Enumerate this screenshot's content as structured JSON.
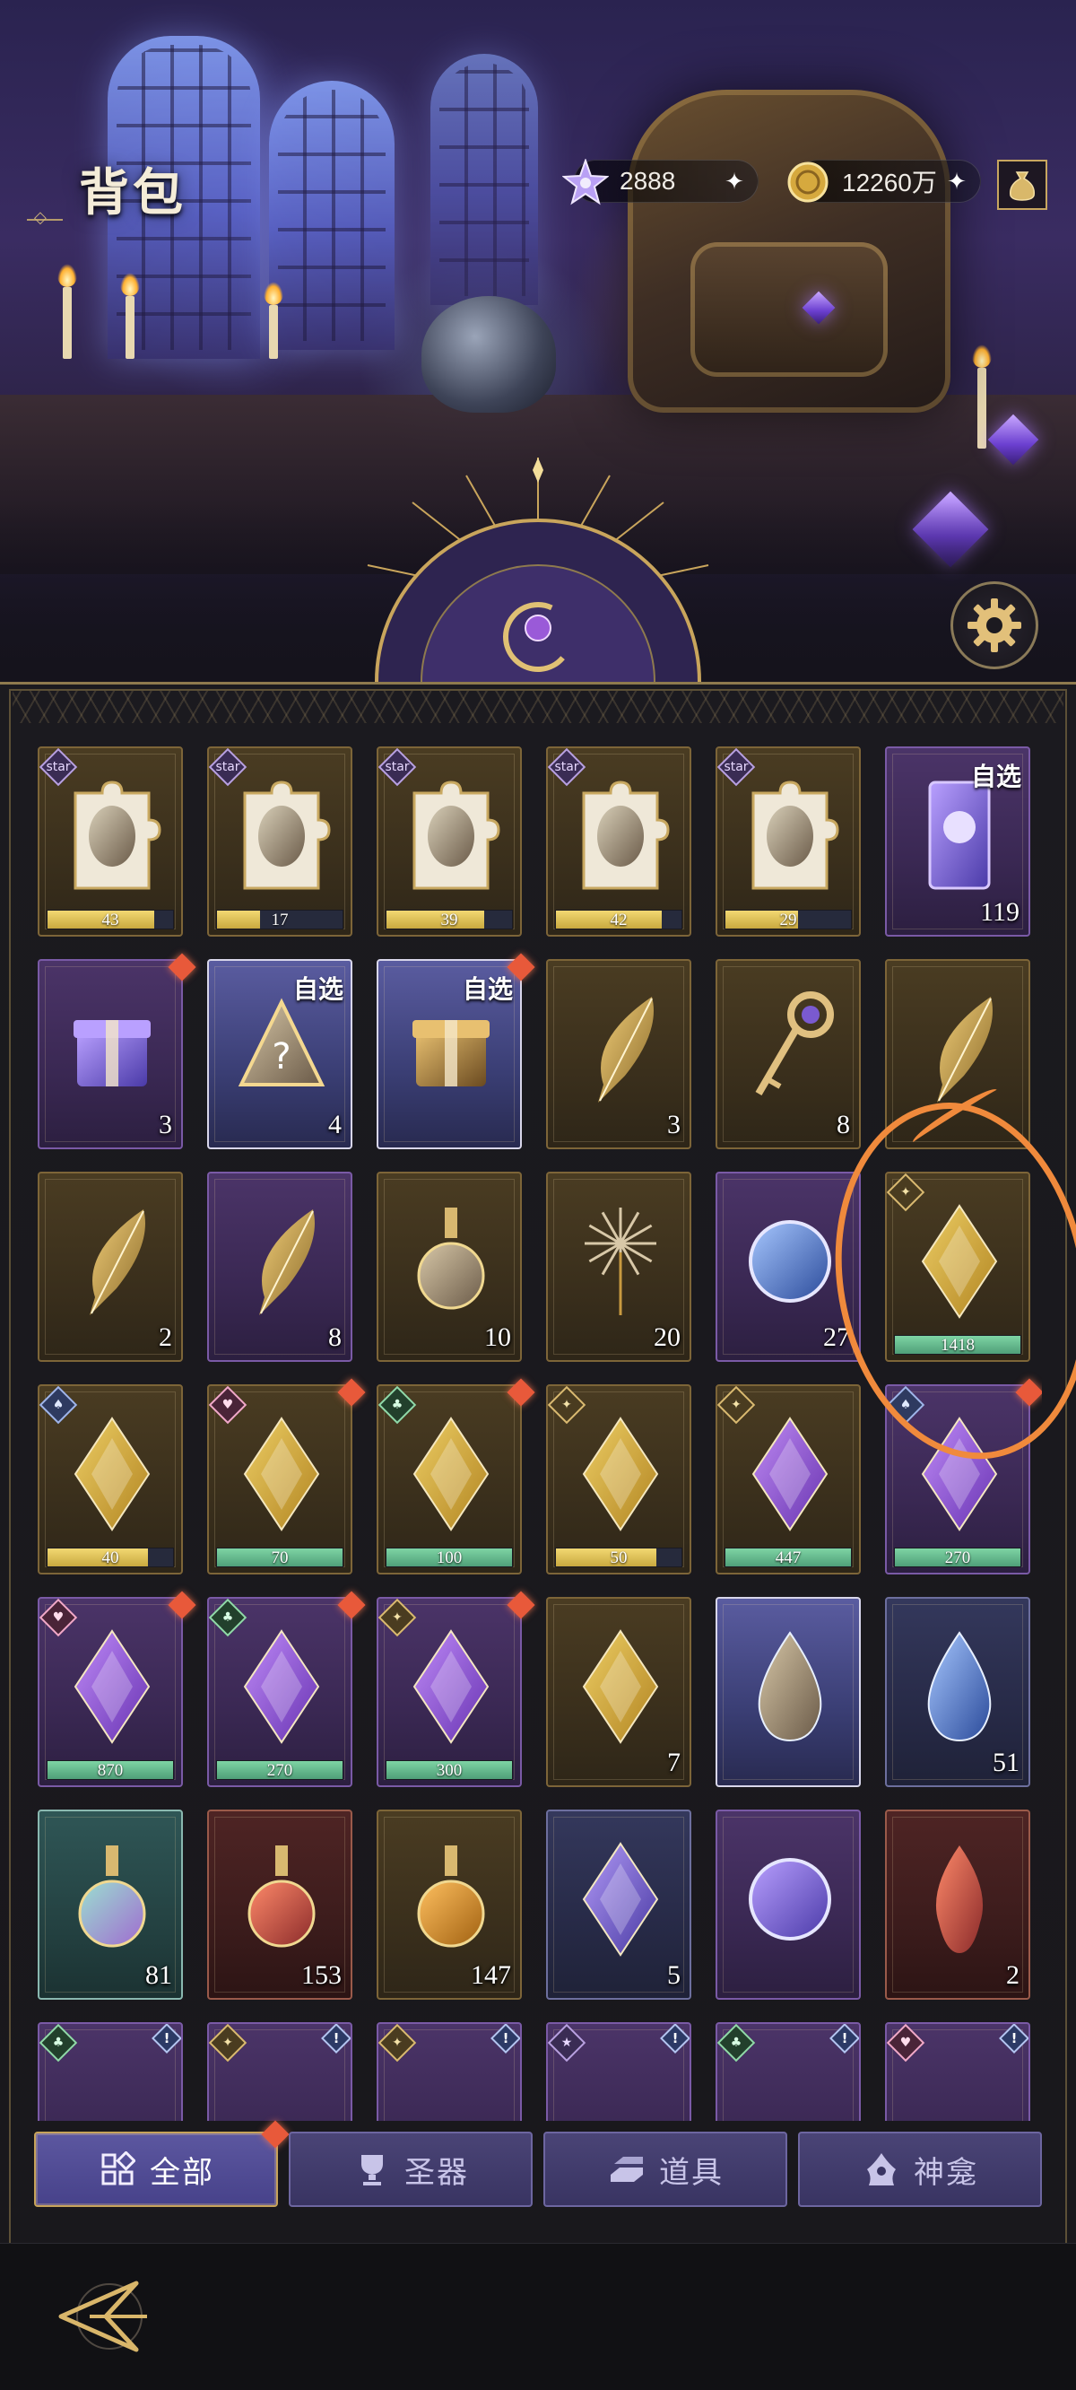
{
  "header": {
    "title": "背包",
    "currencies": [
      {
        "name": "star-crystal",
        "value": "2888"
      },
      {
        "name": "gold-coin",
        "value": "12260万"
      }
    ]
  },
  "items": [
    {
      "row": 0,
      "col": 0,
      "frame": "gold",
      "art": "puzzle-portrait-silver-hair",
      "badge": "star",
      "badge_color": "purple",
      "bar_value": "43",
      "bar_color": "yellow",
      "bar_fill": 0.85
    },
    {
      "row": 0,
      "col": 1,
      "frame": "gold",
      "art": "puzzle-portrait-dark-hair",
      "badge": "star",
      "badge_color": "purple",
      "bar_value": "17",
      "bar_color": "yellow",
      "bar_fill": 0.34
    },
    {
      "row": 0,
      "col": 2,
      "frame": "gold",
      "art": "puzzle-portrait-blonde",
      "badge": "star",
      "badge_color": "purple",
      "bar_value": "39",
      "bar_color": "yellow",
      "bar_fill": 0.78
    },
    {
      "row": 0,
      "col": 3,
      "frame": "gold",
      "art": "puzzle-portrait-dark-long-hair",
      "badge": "star",
      "badge_color": "purple",
      "bar_value": "42",
      "bar_color": "yellow",
      "bar_fill": 0.84
    },
    {
      "row": 0,
      "col": 4,
      "frame": "gold",
      "art": "puzzle-portrait-shadow",
      "badge": "star",
      "badge_color": "purple",
      "bar_value": "29",
      "bar_color": "yellow",
      "bar_fill": 0.58
    },
    {
      "row": 0,
      "col": 5,
      "frame": "purple",
      "art": "tarot-card",
      "pick_label": "自选",
      "quantity": "119"
    },
    {
      "row": 1,
      "col": 0,
      "frame": "purple",
      "art": "gift-box",
      "quantity": "3",
      "new": true
    },
    {
      "row": 1,
      "col": 1,
      "frame": "silver",
      "art": "mystery-triangle",
      "pick_label": "自选",
      "quantity": "4"
    },
    {
      "row": 1,
      "col": 2,
      "frame": "silver",
      "art": "treasure-chest",
      "pick_label": "自选",
      "new": true
    },
    {
      "row": 1,
      "col": 3,
      "frame": "gold",
      "art": "golden-feather",
      "quantity": "3"
    },
    {
      "row": 1,
      "col": 4,
      "frame": "gold",
      "art": "jeweled-key",
      "quantity": "8"
    },
    {
      "row": 1,
      "col": 5,
      "frame": "gold",
      "art": "heart-feather"
    },
    {
      "row": 2,
      "col": 0,
      "frame": "gold",
      "art": "clover-feather",
      "quantity": "2"
    },
    {
      "row": 2,
      "col": 1,
      "frame": "purple",
      "art": "dark-feather",
      "quantity": "8"
    },
    {
      "row": 2,
      "col": 2,
      "frame": "gold",
      "art": "perfume-bottle",
      "quantity": "10"
    },
    {
      "row": 2,
      "col": 3,
      "frame": "gold",
      "art": "fireworks",
      "quantity": "20"
    },
    {
      "row": 2,
      "col": 4,
      "frame": "purple",
      "art": "blue-medallion",
      "quantity": "27"
    },
    {
      "row": 2,
      "col": 5,
      "frame": "gold",
      "art": "gold-crystal-bird",
      "badge": "✦",
      "badge_color": "gold",
      "bar_value": "1418",
      "bar_color": "green",
      "bar_fill": 1.0
    },
    {
      "row": 3,
      "col": 0,
      "frame": "gold",
      "art": "gold-crystal-spade",
      "badge": "♠",
      "badge_color": "blue",
      "bar_value": "40",
      "bar_color": "yellow",
      "bar_fill": 0.8
    },
    {
      "row": 3,
      "col": 1,
      "frame": "gold",
      "art": "gold-crystal-heart",
      "badge": "♥",
      "badge_color": "pink",
      "bar_value": "70",
      "bar_color": "green",
      "bar_fill": 1.0,
      "new": true
    },
    {
      "row": 3,
      "col": 2,
      "frame": "gold",
      "art": "gold-crystal-club",
      "badge": "♣",
      "badge_color": "green",
      "bar_value": "100",
      "bar_color": "green",
      "bar_fill": 1.0,
      "new": true
    },
    {
      "row": 3,
      "col": 3,
      "frame": "gold",
      "art": "gold-crystal-star",
      "badge": "✦",
      "badge_color": "gold",
      "bar_value": "50",
      "bar_color": "yellow",
      "bar_fill": 0.8
    },
    {
      "row": 3,
      "col": 4,
      "frame": "gold",
      "art": "purple-crystal-bird",
      "badge": "✦",
      "badge_color": "gold",
      "bar_value": "447",
      "bar_color": "green",
      "bar_fill": 1.0
    },
    {
      "row": 3,
      "col": 5,
      "frame": "purple",
      "art": "purple-crystal-spade",
      "badge": "♠",
      "badge_color": "blue",
      "bar_value": "270",
      "bar_color": "green",
      "bar_fill": 1.0,
      "new": true
    },
    {
      "row": 4,
      "col": 0,
      "frame": "purple",
      "art": "purple-crystal-heart",
      "badge": "♥",
      "badge_color": "pink",
      "bar_value": "870",
      "bar_color": "green",
      "bar_fill": 1.0,
      "new": true
    },
    {
      "row": 4,
      "col": 1,
      "frame": "purple",
      "art": "purple-crystal-club",
      "badge": "♣",
      "badge_color": "green",
      "bar_value": "270",
      "bar_color": "green",
      "bar_fill": 1.0,
      "new": true
    },
    {
      "row": 4,
      "col": 2,
      "frame": "purple",
      "art": "purple-crystal-star",
      "badge": "✦",
      "badge_color": "gold",
      "bar_value": "300",
      "bar_color": "green",
      "bar_fill": 1.0,
      "new": true
    },
    {
      "row": 4,
      "col": 3,
      "frame": "gold",
      "art": "swap-crystal",
      "quantity": "7"
    },
    {
      "row": 4,
      "col": 4,
      "frame": "silver",
      "art": "hammer-in-crystal"
    },
    {
      "row": 4,
      "col": 5,
      "frame": "blue",
      "art": "blue-teardrop-gem",
      "quantity": "51"
    },
    {
      "row": 5,
      "col": 0,
      "frame": "teal",
      "art": "heart-pendant",
      "quantity": "81"
    },
    {
      "row": 5,
      "col": 1,
      "frame": "red",
      "art": "red-heart-vial",
      "quantity": "153"
    },
    {
      "row": 5,
      "col": 2,
      "frame": "gold",
      "art": "amber-potion",
      "quantity": "147"
    },
    {
      "row": 5,
      "col": 3,
      "frame": "blue",
      "art": "crystal-dust-pile",
      "quantity": "5"
    },
    {
      "row": 5,
      "col": 4,
      "frame": "purple",
      "art": "magic-orb"
    },
    {
      "row": 5,
      "col": 5,
      "frame": "red",
      "art": "flame-essence",
      "quantity": "2"
    },
    {
      "row": 6,
      "col": 0,
      "frame": "purple",
      "art": "partial-item",
      "badge": "♣",
      "badge_color": "green",
      "alert": "!"
    },
    {
      "row": 6,
      "col": 1,
      "frame": "purple",
      "art": "partial-plant",
      "badge": "✦",
      "badge_color": "gold",
      "alert": "!"
    },
    {
      "row": 6,
      "col": 2,
      "frame": "purple",
      "art": "partial-plant",
      "badge": "✦",
      "badge_color": "gold",
      "alert": "!"
    },
    {
      "row": 6,
      "col": 3,
      "frame": "purple",
      "art": "partial-plant",
      "badge": "★",
      "badge_color": "purple",
      "alert": "!"
    },
    {
      "row": 6,
      "col": 4,
      "frame": "purple",
      "art": "partial-item",
      "badge": "♣",
      "badge_color": "green",
      "alert": "!"
    },
    {
      "row": 6,
      "col": 5,
      "frame": "purple",
      "art": "partial-beads",
      "badge": "♥",
      "badge_color": "pink",
      "alert": "!"
    }
  ],
  "tabs": [
    {
      "label": "全部",
      "icon": "grid-icon",
      "active": true
    },
    {
      "label": "圣器",
      "icon": "chalice-icon",
      "active": false
    },
    {
      "label": "道具",
      "icon": "ingot-icon",
      "active": false
    },
    {
      "label": "神龛",
      "icon": "shrine-icon",
      "active": false
    }
  ],
  "colors": {
    "accent_gold": "#c7a35a",
    "annotation": "#f08a3c",
    "new_marker": "#e8593a"
  }
}
